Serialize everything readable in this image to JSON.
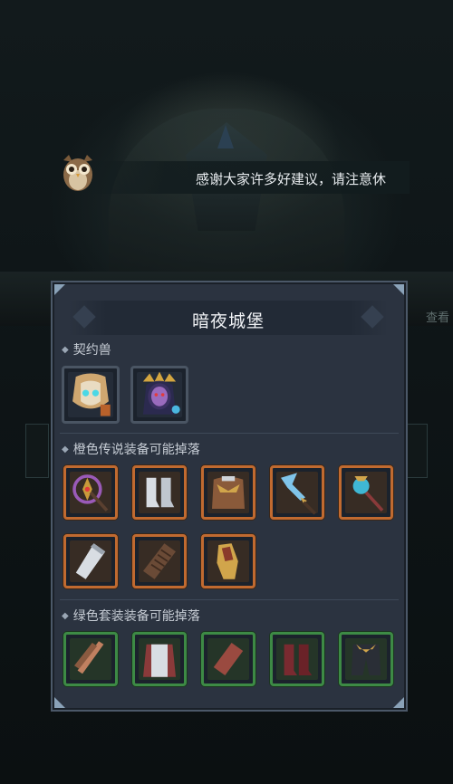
{
  "background": {
    "side_button_text": "查看"
  },
  "message": {
    "text": "感谢大家许多好建议，请注意休"
  },
  "panel": {
    "title": "暗夜城堡",
    "sections": {
      "pets": {
        "label": "契约兽"
      },
      "orange": {
        "label": "橙色传说装备可能掉落"
      },
      "green": {
        "label": "绿色套装装备可能掉落"
      }
    }
  },
  "colors": {
    "orange_border": "#c06a30",
    "green_border": "#3d8a45",
    "panel_bg": "#2b3340"
  },
  "items": {
    "pets": [
      "golden-mech-beast-icon",
      "purple-demon-queen-icon"
    ],
    "orange": [
      "purple-gold-spear-icon",
      "white-boots-icon",
      "gold-belt-armor-icon",
      "blue-crystal-blade-icon",
      "blue-orb-staff-icon",
      "white-bracer-icon",
      "brown-bracer-icon",
      "gold-gauntlet-icon"
    ],
    "green": [
      "bronze-claw-icon",
      "red-armor-robe-icon",
      "leather-bracer-icon",
      "red-boots-icon",
      "dark-gold-pants-icon"
    ]
  }
}
